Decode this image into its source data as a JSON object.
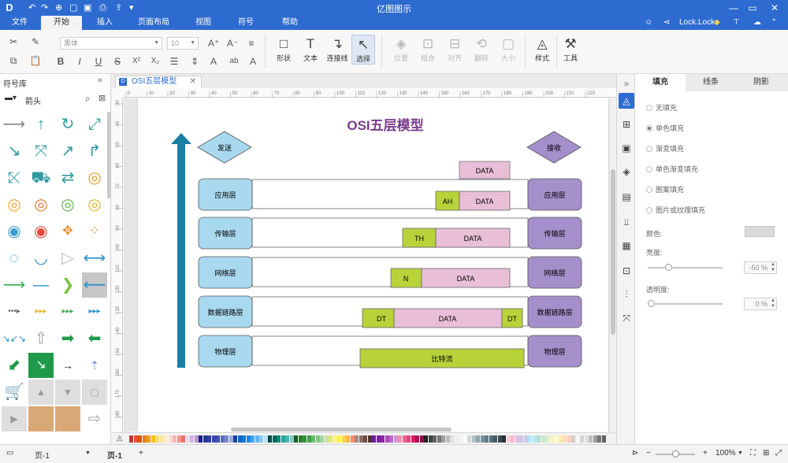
{
  "app": {
    "title": "亿图图示",
    "logo": "D",
    "quick_access_icons": [
      "undo-icon",
      "redo-icon",
      "new-icon",
      "open-icon",
      "save-icon",
      "print-icon",
      "export-icon",
      "more-icon"
    ],
    "window_controls": [
      "minimize-icon",
      "maximize-icon",
      "close-icon"
    ]
  },
  "menu": {
    "tabs": [
      "文件",
      "开始",
      "插入",
      "页面布局",
      "视图",
      "符号",
      "帮助"
    ],
    "active_tab": "开始",
    "user": "Lock.Lock"
  },
  "ribbon": {
    "font_name": "黑体",
    "font_size": "10",
    "big_buttons": {
      "shape": "形状",
      "text": "文本",
      "connector": "连接线",
      "select": "选择",
      "position": "位置",
      "group": "组合",
      "align": "对齐",
      "rotate": "翻转",
      "size": "大小",
      "style": "样式",
      "tools": "工具"
    },
    "small_glyphs": {
      "bold": "B",
      "italic": "I",
      "underline": "U",
      "strike": "S",
      "superscript": "X²",
      "subscript": "X₂",
      "font_bigger": "A⁺",
      "font_smaller": "A⁻",
      "align": "≡",
      "color": "A",
      "case": "ab"
    }
  },
  "symbol_library": {
    "header": "符号库",
    "collapse": "«",
    "current_library": "箭头",
    "symbols": [
      "line-arrow-icon",
      "up-arrow-icon",
      "refresh-arrow-icon",
      "diagonal-arrow-icon",
      "down-right-arrow-icon",
      "expand-arrows-icon",
      "trend-arrow-icon",
      "turn-arrow-icon",
      "shrink-arrows-icon",
      "cart-arrow-icon",
      "swap-arrows-icon",
      "circle-arrows-icon",
      "ring-arrows-icon",
      "ring-arrows-icon",
      "ring-arrows-icon",
      "ring-arrows-icon",
      "ring-arrows-icon",
      "target-arrows-icon",
      "cross-arrows-icon",
      "dotted-circle-icon",
      "arc-arrow-icon",
      "curve-arrow-icon",
      "triangle-arrow-icon",
      "double-arrow-icon",
      "green-arrow-icon",
      "blue-line-icon",
      "chevron-arrow-icon",
      "blue-left-arrow-icon",
      "dots-arrow-icon",
      "dots-arrow-icon",
      "dots-arrow-icon",
      "dots-arrow-icon",
      "small-arrows-icon",
      "up-outline-arrow-icon",
      "green-right-arrow-icon",
      "green-left-arrow-icon",
      "green-diag-arrow-icon",
      "green-box-arrow-icon",
      "black-arrow-icon",
      "pin-arrow-icon",
      "cart-icon",
      "up-button-icon",
      "down-button-icon",
      "box-icon",
      "play-button-icon",
      "folder-tab-icon",
      "folder-tab-icon",
      "right-outline-arrow-icon"
    ]
  },
  "document": {
    "tab_title": "OSI五层模型",
    "tab_icon": "D",
    "ruler_h": [
      "0",
      "10",
      "20",
      "30",
      "40",
      "50",
      "60",
      "70",
      "80",
      "90",
      "100",
      "110",
      "120",
      "130",
      "140",
      "150",
      "160",
      "170",
      "180",
      "190",
      "200",
      "210",
      "220"
    ],
    "ruler_v": [
      "30",
      "40",
      "50",
      "60",
      "70",
      "80",
      "90",
      "100",
      "110",
      "120",
      "130",
      "140",
      "150",
      "160",
      "170",
      "180"
    ]
  },
  "diagram": {
    "title": "OSI五层模型",
    "send_label": "发送",
    "receive_label": "接收",
    "top_data": "DATA",
    "layers": [
      {
        "name": "应用层",
        "header": "AH",
        "data": "DATA"
      },
      {
        "name": "传输层",
        "header": "TH",
        "data": "DATA"
      },
      {
        "name": "网络层",
        "header": "N",
        "data": "DATA"
      },
      {
        "name": "数据链路层",
        "header": "DT",
        "data": "DATA",
        "trailer": "DT"
      },
      {
        "name": "物理层",
        "bitstream": "比特流"
      }
    ],
    "colors": {
      "title": "#7a3d8c",
      "arrow": "#1a7fa3",
      "left_box": "#a9d9ef",
      "right_box": "#a58fcb",
      "header": "#b8d23a",
      "data": "#e8bfd6"
    }
  },
  "format_panel": {
    "tabs": [
      "填充",
      "线条",
      "阴影"
    ],
    "active_tab": "填充",
    "fill_options": [
      "无填充",
      "单色填充",
      "渐变填充",
      "单色渐变填充",
      "图案填充",
      "图片或纹理填充"
    ],
    "selected_option": "单色填充",
    "color_label": "颜色:",
    "brightness_label": "亮度:",
    "brightness_value": "-50 %",
    "brightness_level": 0.24,
    "transparency_label": "透明度:",
    "transparency_value": "0 %",
    "transparency_level": 0.0
  },
  "status": {
    "page_select": "页-1",
    "page_tab": "页-1",
    "add_page": "+",
    "zoom": "100%",
    "zoom_level": 0.5,
    "zoom_minus": "−",
    "zoom_plus": "+"
  }
}
